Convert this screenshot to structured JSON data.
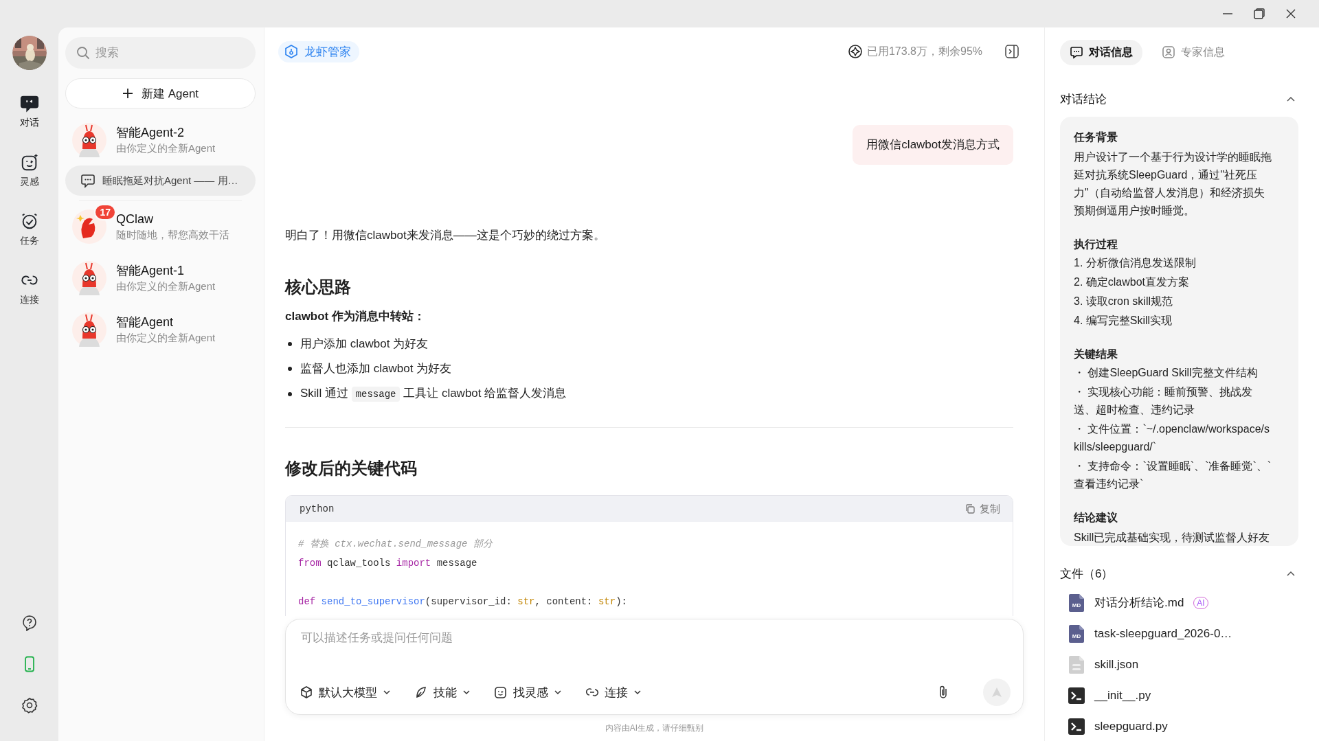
{
  "nav": {
    "items": [
      {
        "label": "对话",
        "kind": "chat",
        "selected": true
      },
      {
        "label": "灵感",
        "kind": "inspiration",
        "selected": false
      },
      {
        "label": "任务",
        "kind": "task",
        "selected": false
      },
      {
        "label": "连接",
        "kind": "connect",
        "selected": false
      }
    ]
  },
  "search": {
    "placeholder": "搜索"
  },
  "new_agent_button": {
    "label": "新建 Agent"
  },
  "agents": [
    {
      "name": "智能Agent-2",
      "subtitle": "由你定义的全新Agent",
      "kind": "lobster",
      "conversations": [
        {
          "title": "睡眠拖延对抗Agent —— 用…",
          "selected": true
        }
      ]
    },
    {
      "name": "QClaw",
      "subtitle": "随时随地，帮您高效干活",
      "kind": "claw",
      "badge": "17"
    },
    {
      "name": "智能Agent-1",
      "subtitle": "由你定义的全新Agent",
      "kind": "lobster"
    },
    {
      "name": "智能Agent",
      "subtitle": "由你定义的全新Agent",
      "kind": "lobster"
    }
  ],
  "chat": {
    "agent_tag": "龙虾管家",
    "usage": "已用173.8万，剩余95%",
    "messages": [
      {
        "kind": "user",
        "text": "用微信clawbot发消息方式"
      },
      {
        "kind": "assistant",
        "blocks": [
          {
            "kind": "paragraph",
            "text": "明白了！用微信clawbot来发消息——这是个巧妙的绕过方案。"
          },
          {
            "kind": "heading",
            "text": "核心思路"
          },
          {
            "kind": "strong",
            "text": "clawbot 作为消息中转站："
          },
          {
            "kind": "bullets",
            "items": [
              {
                "parts": [
                  {
                    "text": "用户添加 clawbot 为好友"
                  }
                ]
              },
              {
                "parts": [
                  {
                    "text": "监督人也添加 clawbot 为好友"
                  }
                ]
              },
              {
                "parts": [
                  {
                    "text": "Skill 通过 "
                  },
                  {
                    "code": "message"
                  },
                  {
                    "text": " 工具让 clawbot 给监督人发消息"
                  }
                ]
              }
            ]
          },
          {
            "kind": "rule"
          },
          {
            "kind": "heading",
            "text": "修改后的关键代码"
          },
          {
            "kind": "code",
            "language": "python",
            "copy_label": "复制",
            "groups": [
              [
                [
                  {
                    "kind": "comment",
                    "text": "# 替换 ctx.wechat.send_message 部分"
                  }
                ],
                [
                  {
                    "kind": "keyword",
                    "text": "from"
                  },
                  {
                    "kind": "plain",
                    "text": " qclaw_tools "
                  },
                  {
                    "kind": "keyword",
                    "text": "import"
                  },
                  {
                    "kind": "plain",
                    "text": " message"
                  }
                ]
              ],
              [
                [
                  {
                    "kind": "keyword",
                    "text": "def"
                  },
                  {
                    "kind": "function",
                    "text": " send_to_supervisor"
                  },
                  {
                    "kind": "plain",
                    "text": "(supervisor_id: "
                  },
                  {
                    "kind": "builtin",
                    "text": "str"
                  },
                  {
                    "kind": "plain",
                    "text": ", content: "
                  },
                  {
                    "kind": "builtin",
                    "text": "str"
                  },
                  {
                    "kind": "plain",
                    "text": "):"
                  }
                ]
              ]
            ]
          }
        ]
      }
    ]
  },
  "composer": {
    "placeholder": "可以描述任务或提问任何问题",
    "tools": [
      {
        "label": "默认大模型",
        "kind": "model"
      },
      {
        "label": "技能",
        "kind": "skill"
      },
      {
        "label": "找灵感",
        "kind": "inspiration"
      },
      {
        "label": "连接",
        "kind": "connect"
      }
    ],
    "send_disabled": true
  },
  "footer_note": "内容由AI生成，请仔细甄别",
  "side_panel": {
    "tabs": [
      {
        "label": "对话信息",
        "kind": "chat",
        "selected": true
      },
      {
        "label": "专家信息",
        "kind": "expert",
        "selected": false
      }
    ],
    "summary": {
      "title": "对话结论",
      "expanded": true,
      "sections": [
        {
          "heading": "任务背景",
          "kind": "paragraph",
          "text": "用户设计了一个基于行为设计学的睡眠拖延对抗系统SleepGuard，通过\"社死压力\"（自动给监督人发消息）和经济损失预期倒逼用户按时睡觉。"
        },
        {
          "heading": "执行过程",
          "kind": "list",
          "items": [
            "1. 分析微信消息发送限制",
            "2. 确定clawbot直发方案",
            "3. 读取cron skill规范",
            "4. 编写完整Skill实现"
          ]
        },
        {
          "heading": "关键结果",
          "kind": "list",
          "items": [
            "・ 创建SleepGuard Skill完整文件结构",
            "・ 实现核心功能：睡前预警、挑战发送、超时检查、违约记录",
            "・ 文件位置：`~/.openclaw/workspace/skills/sleepguard/`",
            "・ 支持命令：`设置睡眠`、`准备睡觉`、`查看违约记录`"
          ]
        },
        {
          "heading": "结论建议",
          "kind": "paragraph",
          "text": "Skill已完成基础实现，待测试监督人好友"
        }
      ]
    },
    "files": {
      "title": "文件（6）",
      "expanded": true,
      "items": [
        {
          "name": "对话分析结论.md",
          "kind": "md",
          "icon_text": "MD",
          "badge": "AI"
        },
        {
          "name": "task-sleepguard_2026-0…",
          "kind": "md",
          "icon_text": "MD"
        },
        {
          "name": "skill.json",
          "kind": "json"
        },
        {
          "name": "__init__.py",
          "kind": "py"
        },
        {
          "name": "sleepguard.py",
          "kind": "py"
        }
      ]
    }
  }
}
